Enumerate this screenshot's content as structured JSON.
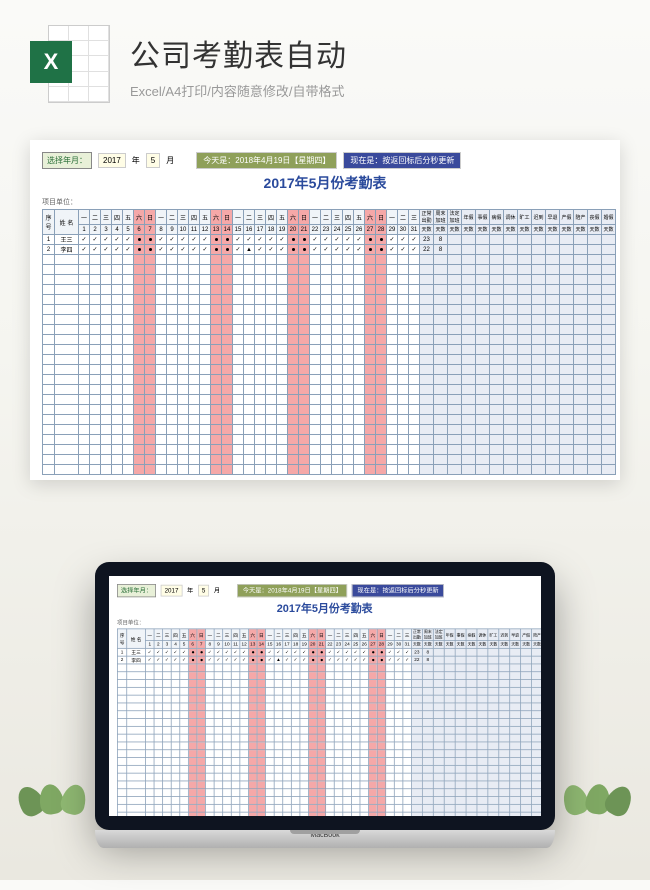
{
  "header": {
    "excel_label": "X",
    "title": "公司考勤表自动",
    "subtitle": "Excel/A4打印/内容随意修改/自带格式"
  },
  "spreadsheet": {
    "select_label": "选择年月：",
    "year": "2017",
    "year_unit": "年",
    "month": "5",
    "month_unit": "月",
    "today_label": "今天是：2018年4月19日【星期四】",
    "time_label": "现在是：按返回标后分秒更新",
    "title": "2017年5月份考勤表",
    "sub_label": "项目单位：",
    "head_seq": "序号",
    "head_name": "姓 名",
    "weekdays": [
      "一",
      "二",
      "三",
      "四",
      "五",
      "六",
      "日",
      "一",
      "二",
      "三",
      "四",
      "五",
      "六",
      "日",
      "一",
      "二",
      "三",
      "四",
      "五",
      "六",
      "日",
      "一",
      "二",
      "三",
      "四",
      "五",
      "六",
      "日",
      "一",
      "二",
      "三"
    ],
    "days": [
      "1",
      "2",
      "3",
      "4",
      "5",
      "6",
      "7",
      "8",
      "9",
      "10",
      "11",
      "12",
      "13",
      "14",
      "15",
      "16",
      "17",
      "18",
      "19",
      "20",
      "21",
      "22",
      "23",
      "24",
      "25",
      "26",
      "27",
      "28",
      "29",
      "30",
      "31"
    ],
    "summary_cols": [
      "正常出勤",
      "周末加班",
      "法定加班",
      "年假",
      "事假",
      "病假",
      "调休",
      "旷工",
      "迟到",
      "早退",
      "产假",
      "陪产",
      "丧假",
      "婚假"
    ],
    "summary_unit": "天数",
    "rows": [
      {
        "seq": "1",
        "name": "王三",
        "marks": [
          "✓",
          "✓",
          "✓",
          "✓",
          "✓",
          "●",
          "●",
          "✓",
          "✓",
          "✓",
          "✓",
          "✓",
          "●",
          "●",
          "✓",
          "✓",
          "✓",
          "✓",
          "✓",
          "●",
          "●",
          "✓",
          "✓",
          "✓",
          "✓",
          "✓",
          "●",
          "●",
          "✓",
          "✓",
          "✓"
        ],
        "sum": [
          "23",
          "8",
          "",
          "",
          "",
          "",
          "",
          "",
          "",
          "",
          "",
          "",
          "",
          ""
        ]
      },
      {
        "seq": "2",
        "name": "李四",
        "marks": [
          "✓",
          "✓",
          "✓",
          "✓",
          "✓",
          "●",
          "●",
          "✓",
          "✓",
          "✓",
          "✓",
          "✓",
          "●",
          "●",
          "✓",
          "▲",
          "✓",
          "✓",
          "✓",
          "●",
          "●",
          "✓",
          "✓",
          "✓",
          "✓",
          "✓",
          "●",
          "●",
          "✓",
          "✓",
          "✓"
        ],
        "sum": [
          "22",
          "8",
          "",
          "",
          "",
          "",
          "",
          "",
          "",
          "",
          "",
          "",
          "",
          ""
        ]
      }
    ]
  },
  "laptop": {
    "brand": "MacBook"
  }
}
